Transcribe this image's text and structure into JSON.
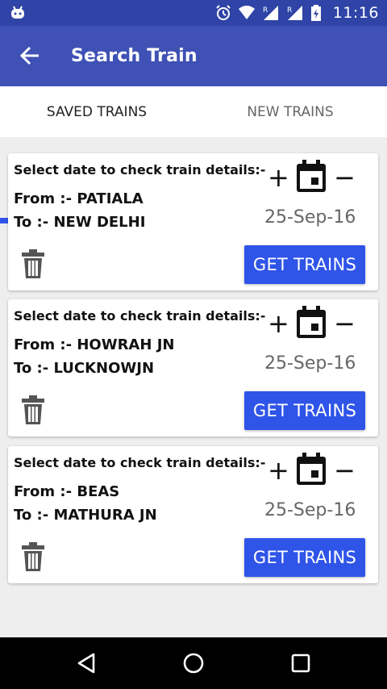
{
  "status_bar": {
    "time": "11:16",
    "icons": [
      "android-icon",
      "alarm-icon",
      "wifi-icon",
      "signal-r-icon",
      "signal-r-icon",
      "battery-charging-icon"
    ]
  },
  "app_bar": {
    "title": "Search Train",
    "back_icon": "arrow-back-icon"
  },
  "tabs": [
    {
      "label": "SAVED TRAINS",
      "active": true
    },
    {
      "label": "NEW TRAINS",
      "active": false
    }
  ],
  "cards": [
    {
      "prompt": "Select date to check train details:-",
      "from": "From :- PATIALA",
      "to": "To :- NEW DELHI",
      "plus": "+",
      "minus": "−",
      "date": "25-Sep-16",
      "button": "GET TRAINS"
    },
    {
      "prompt": "Select date to check train details:-",
      "from": "From :- HOWRAH JN",
      "to": "To :- LUCKNOWJN",
      "plus": "+",
      "minus": "−",
      "date": "25-Sep-16",
      "button": "GET TRAINS"
    },
    {
      "prompt": "Select date to check train details:-",
      "from": "From :- BEAS",
      "to": "To :- MATHURA JN",
      "plus": "+",
      "minus": "−",
      "date": "25-Sep-16",
      "button": "GET TRAINS"
    }
  ],
  "colors": {
    "status_bar": "#2f44a6",
    "app_bar": "#3f51b5",
    "accent": "#2f54e8",
    "background": "#eeeeee"
  },
  "nav_bar": {
    "icons": [
      "back-triangle-icon",
      "home-circle-icon",
      "recents-square-icon"
    ]
  }
}
